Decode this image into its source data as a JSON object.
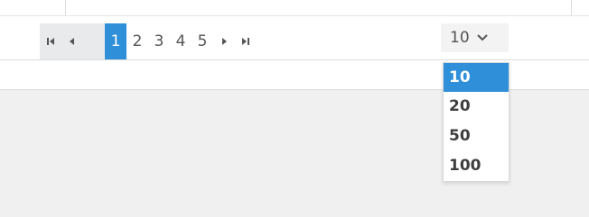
{
  "pager": {
    "first_icon": "first-page-icon",
    "prev_icon": "previous-page-icon",
    "next_icon": "next-page-icon",
    "last_icon": "last-page-icon",
    "pages": [
      "1",
      "2",
      "3",
      "4",
      "5"
    ],
    "current_page": "1",
    "accent_color": "#2f8fd8"
  },
  "page_size": {
    "value": "10",
    "chevron_icon": "chevron-down-icon",
    "options": [
      "10",
      "20",
      "50",
      "100"
    ],
    "selected": "10"
  }
}
